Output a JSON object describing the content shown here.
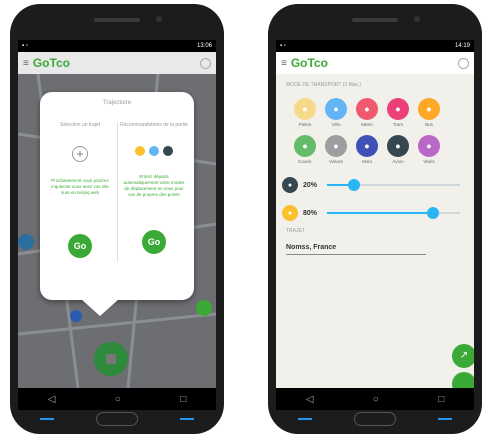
{
  "left_phone": {
    "status_time": "13:06",
    "logo": "GoTco",
    "dialog": {
      "title": "Trajectoire",
      "left_heading": "Sélection un trajet",
      "right_heading": "Recommandations de la partie",
      "left_text": "Prochainement vous pourrez inquiecter vous avez vos site sure en tenpiq web",
      "right_text": "Entrez départs automatiquement votre modes de déplacement en vous pour vos de propres des points",
      "go_label": "Go",
      "plus_symbol": "+"
    }
  },
  "right_phone": {
    "status_time": "14:19",
    "logo": "GoTco",
    "mode_section": "MODE DE TRANSPORT (3 Max.)",
    "modes": [
      {
        "label": "Pieton",
        "icon": "walk-icon",
        "color": "#f7d98b"
      },
      {
        "label": "Vélo",
        "icon": "bike-icon",
        "color": "#64b5f6"
      },
      {
        "label": "Metro",
        "icon": "metro-icon",
        "color": "#ef5a6f"
      },
      {
        "label": "Tram",
        "icon": "tram-icon",
        "color": "#ec407a"
      },
      {
        "label": "Bus",
        "icon": "bus-icon",
        "color": "#ffa726"
      },
      {
        "label": "Covoit.",
        "icon": "carpool-icon",
        "color": "#66bb6a"
      },
      {
        "label": "Voiture",
        "icon": "car-icon",
        "color": "#9e9e9e"
      },
      {
        "label": "Moto",
        "icon": "moto-icon",
        "color": "#3f51b5"
      },
      {
        "label": "Avion",
        "icon": "plane-icon",
        "color": "#37474f"
      },
      {
        "label": "Vlaris",
        "icon": "vlaris-icon",
        "color": "#ba68c8"
      }
    ],
    "sliders": [
      {
        "label": "20%",
        "value": 0.2,
        "icon": "bus-icon",
        "color": "#37474f"
      },
      {
        "label": "80%",
        "value": 0.8,
        "icon": "walk-icon",
        "color": "#fbc02d"
      }
    ],
    "trip_section": "TRAJET",
    "trip_field": "Nomss, France"
  },
  "nav": {
    "back": "◁",
    "home": "○",
    "recents": "□"
  }
}
